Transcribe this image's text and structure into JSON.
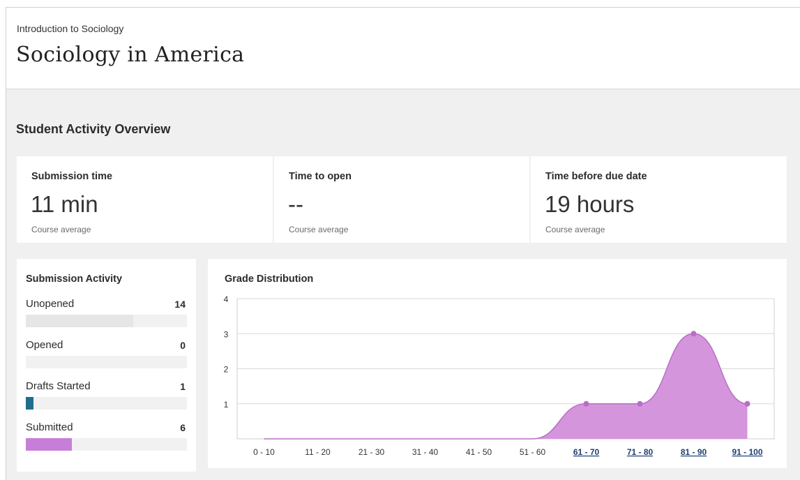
{
  "header": {
    "course_name": "Introduction to Sociology",
    "page_title": "Sociology in America"
  },
  "overview": {
    "title": "Student Activity Overview",
    "cards": [
      {
        "label": "Submission time",
        "value": "11 min",
        "note": "Course average"
      },
      {
        "label": "Time to open",
        "value": "--",
        "note": "Course average"
      },
      {
        "label": "Time before due date",
        "value": "19 hours",
        "note": "Course average"
      }
    ]
  },
  "submission_activity": {
    "title": "Submission Activity",
    "max": 21,
    "items": [
      {
        "label": "Unopened",
        "count": "14",
        "value": 14,
        "color": "#e6e6e6"
      },
      {
        "label": "Opened",
        "count": "0",
        "value": 0,
        "color": "#e6e6e6"
      },
      {
        "label": "Drafts Started",
        "count": "1",
        "value": 1,
        "color": "#1f6d8f"
      },
      {
        "label": "Submitted",
        "count": "6",
        "value": 6,
        "color": "#c77ed8"
      }
    ]
  },
  "chart_data": {
    "type": "area",
    "title": "Grade Distribution",
    "xlabel": "",
    "ylabel": "",
    "categories": [
      "0 - 10",
      "11 - 20",
      "21 - 30",
      "31 - 40",
      "41 - 50",
      "51 - 60",
      "61 - 70",
      "71 - 80",
      "81 - 90",
      "91 - 100"
    ],
    "linked_categories": [
      "61 - 70",
      "71 - 80",
      "81 - 90",
      "91 - 100"
    ],
    "values": [
      0,
      0,
      0,
      0,
      0,
      0,
      1,
      1,
      3,
      1
    ],
    "yticks": [
      1,
      2,
      3,
      4
    ],
    "ylim": [
      0,
      4
    ],
    "grid": true,
    "fill_color": "#d495dd",
    "line_color": "#b96ec6"
  }
}
